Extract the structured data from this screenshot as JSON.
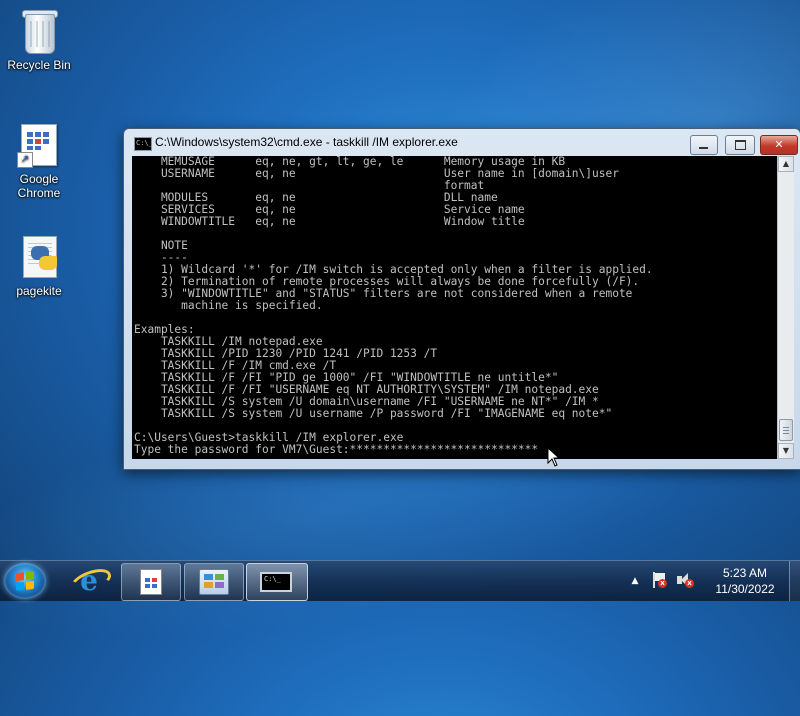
{
  "desktop": {
    "icons": [
      {
        "label": "Recycle Bin",
        "icon": "recycle-bin-icon"
      },
      {
        "label": "Google\nChrome",
        "icon": "chrome-shortcut-icon"
      },
      {
        "label": "pagekite",
        "icon": "python-file-icon"
      }
    ]
  },
  "window": {
    "title": "C:\\Windows\\system32\\cmd.exe - taskkill  /IM explorer.exe",
    "console_lines": [
      "    MEMUSAGE      eq, ne, gt, lt, ge, le      Memory usage in KB",
      "    USERNAME      eq, ne                      User name in [domain\\]user",
      "                                              format",
      "    MODULES       eq, ne                      DLL name",
      "    SERVICES      eq, ne                      Service name",
      "    WINDOWTITLE   eq, ne                      Window title",
      "",
      "    NOTE",
      "    ----",
      "    1) Wildcard '*' for /IM switch is accepted only when a filter is applied.",
      "    2) Termination of remote processes will always be done forcefully (/F).",
      "    3) \"WINDOWTITLE\" and \"STATUS\" filters are not considered when a remote",
      "       machine is specified.",
      "",
      "Examples:",
      "    TASKKILL /IM notepad.exe",
      "    TASKKILL /PID 1230 /PID 1241 /PID 1253 /T",
      "    TASKKILL /F /IM cmd.exe /T",
      "    TASKKILL /F /FI \"PID ge 1000\" /FI \"WINDOWTITLE ne untitle*\"",
      "    TASKKILL /F /FI \"USERNAME eq NT AUTHORITY\\SYSTEM\" /IM notepad.exe",
      "    TASKKILL /S system /U domain\\username /FI \"USERNAME ne NT*\" /IM *",
      "    TASKKILL /S system /U username /P password /FI \"IMAGENAME eq note*\"",
      "",
      "C:\\Users\\Guest>taskkill /IM explorer.exe",
      "Type the password for VM7\\Guest:****************************"
    ]
  },
  "taskbar": {
    "items": [
      "internet-explorer",
      "document-shortcut",
      "control-panel",
      "command-prompt"
    ],
    "cmd_glyph": "C:\\_",
    "tray": {
      "time": "5:23 AM",
      "date": "11/30/2022"
    }
  }
}
